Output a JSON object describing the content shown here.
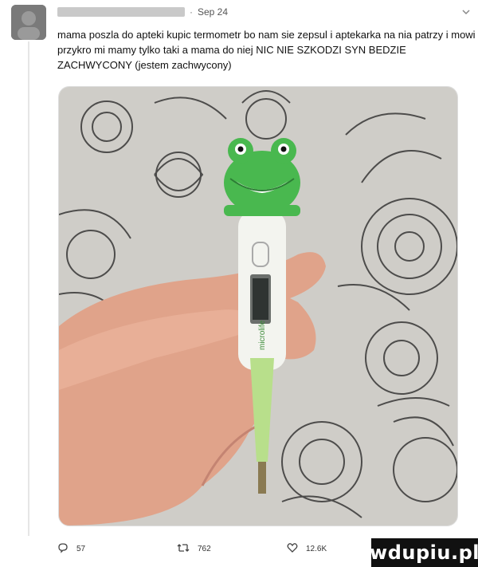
{
  "tweet": {
    "date": "Sep 24",
    "text": "mama poszla do apteki kupic termometr bo nam sie zepsul i aptekarka na nia patrzy i mowi przykro mi mamy tylko taki a mama do niej NIC NIE SZKODZI SYN BEDZIE ZACHWYCONY (jestem zachwycony)",
    "media_brand_text": "microlife",
    "actions": {
      "reply_count": "57",
      "retweet_count": "762",
      "like_count": "12.6K"
    }
  },
  "watermark": {
    "text": "wdupiu.pl"
  },
  "icons": {
    "reply": "reply-icon",
    "retweet": "retweet-icon",
    "like": "heart-icon",
    "share": "share-icon",
    "menu": "chevron-down-icon"
  },
  "colors": {
    "frog_green": "#49b84f",
    "thermometer_body": "#f3f4ef",
    "icon_gray": "#444444"
  }
}
